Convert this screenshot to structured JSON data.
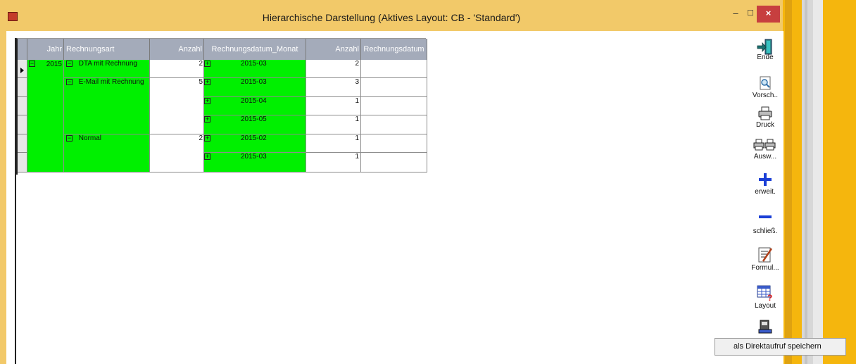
{
  "window": {
    "title": "Hierarchische Darstellung (Aktives Layout: CB - 'Standard')",
    "min_icon": "minimize-icon",
    "max_icon": "maximize-icon",
    "close_icon": "close-icon",
    "close_glyph": "×"
  },
  "grid": {
    "columns": [
      "Jahr",
      "Rechnungsart",
      "Anzahl",
      "Rechnungsdatum_Monat",
      "Anzahl",
      "Rechnungsdatum"
    ],
    "year": "2015",
    "groups": [
      {
        "art": "DTA mit Rechnung",
        "count": "2"
      },
      {
        "art": "E-Mail mit Rechnung",
        "count": "5"
      },
      {
        "art": "Normal",
        "count": "2"
      }
    ],
    "months": [
      {
        "month": "2015-03",
        "count": "2"
      },
      {
        "month": "2015-03",
        "count": "3"
      },
      {
        "month": "2015-04",
        "count": "1"
      },
      {
        "month": "2015-05",
        "count": "1"
      },
      {
        "month": "2015-02",
        "count": "1"
      },
      {
        "month": "2015-03",
        "count": "1"
      }
    ],
    "collapse_glyph": "−",
    "expand_glyph": "+"
  },
  "toolbar": {
    "ende": "Ende",
    "vorschau": "Vorsch..",
    "druck": "Druck",
    "auswahl": "Ausw...",
    "erweit": "erweit.",
    "schliess": "schließ.",
    "formular": "Formul...",
    "layout": "Layout"
  },
  "context_menu": {
    "item": "als Direktaufruf speichern"
  },
  "colors": {
    "group_bg": "#00f000",
    "header_bg": "#a4abba",
    "titlebar": "#f2c969",
    "close_btn": "#c73f3f"
  }
}
